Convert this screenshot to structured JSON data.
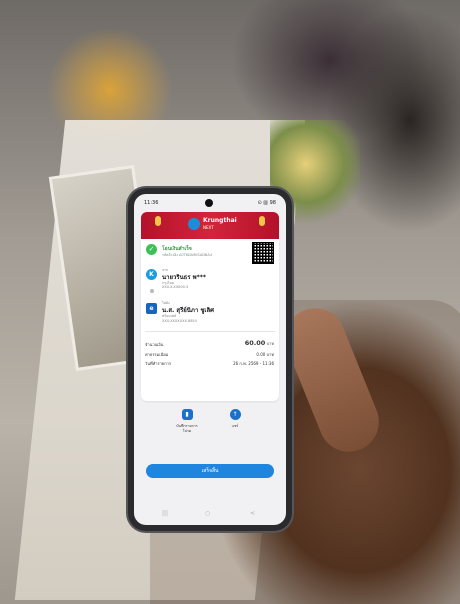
{
  "status_bar": {
    "time": "11:36",
    "indicators": "⊙ ▥ 98"
  },
  "banner": {
    "brand": "Krungthai",
    "sub": "NEXT"
  },
  "slip": {
    "status_title": "โอนเงินสำเร็จ",
    "reference": "รหัสอ้างอิง A0T8DA9KSADBA4",
    "from_label": "จาก",
    "from_name": "นายวรินธร พ***",
    "from_bank": "กรุงไทย",
    "from_account": "XXX-X-XX800-5",
    "to_label": "ไปยัง",
    "to_name": "น.ส. สุรีย์นิภา ชูเลิศ",
    "to_bank": "พร้อมเพย์",
    "to_account": "XXX-XXXXXXX-8654",
    "amount_label": "จำนวนเงิน",
    "amount_value": "60.00",
    "amount_unit": "บาท",
    "fee_label": "ค่าธรรมเนียม",
    "fee_value": "0.00 บาท",
    "date_label": "วันที่ทำรายการ",
    "date_value": "26 ก.พ. 2569 - 11:36"
  },
  "actions": {
    "save_icon": "bookmark-icon",
    "save_label_1": "บันทึกรายการ",
    "save_label_2": "โปรด",
    "share_icon": "share-icon",
    "share_label": "แชร์"
  },
  "done_button": "เสร็จสิ้น",
  "colors": {
    "banner": "#c4172f",
    "primary": "#1f86e0",
    "success": "#3fbf5a"
  }
}
